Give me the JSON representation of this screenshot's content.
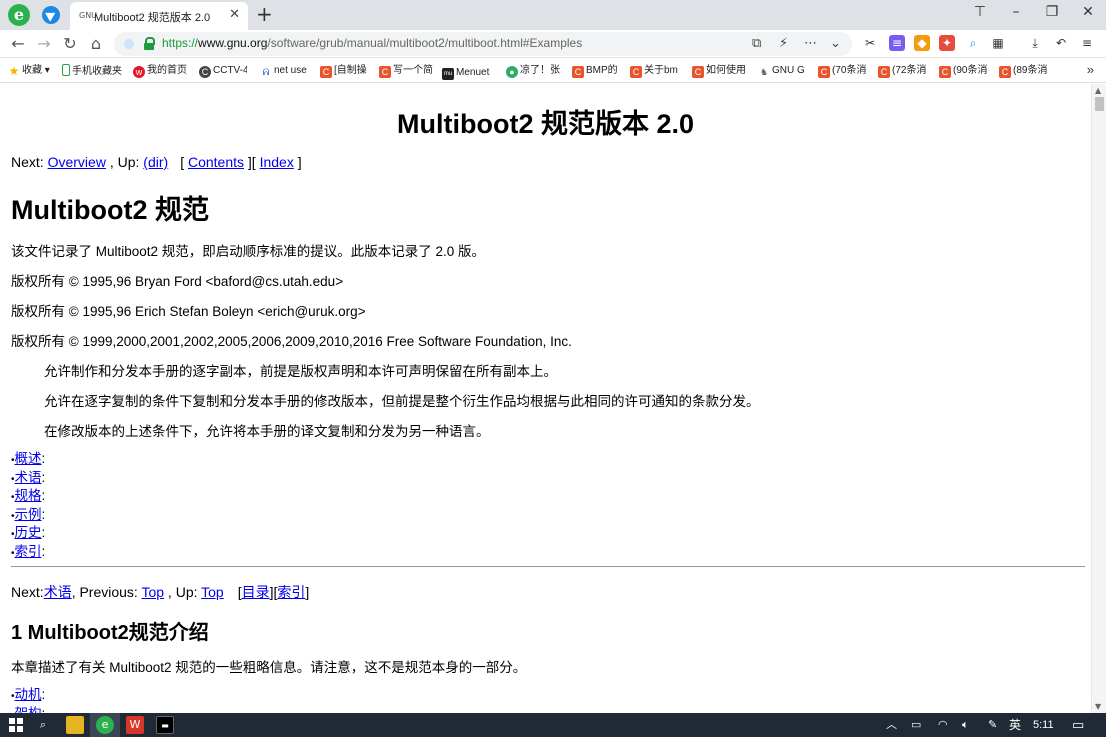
{
  "browser": {
    "tab_favicon": "GNU",
    "tab_title": "Multiboot2 规范版本 2.0",
    "url_scheme": "https://",
    "url_host": "www.gnu.org",
    "url_path": "/software/grub/manual/multiboot2/multiboot.html#Examples",
    "bookmarks": [
      "收藏",
      "手机收藏夹",
      "我的首页",
      "CCTV-4",
      "net use",
      "[自制操",
      "写一个简",
      "Menuet",
      "凉了！张",
      "BMP的",
      "关于bm",
      "如何使用",
      "GNU G",
      "(70条消",
      "(72条消",
      "(90条消",
      "(89条消"
    ],
    "more_label": "»"
  },
  "page": {
    "title": "Multiboot2 规范版本 2.0",
    "nav1": {
      "next_label": "Next: ",
      "next_link": "Overview",
      "up_label": " , Up: ",
      "up_link": "(dir)",
      "open": "[ ",
      "contents_link": "Contents",
      "mid": " ][ ",
      "index_link": "Index",
      "close": " ]"
    },
    "section_title": "Multiboot2 规范",
    "paragraphs": [
      "该文件记录了 Multiboot2 规范，即启动顺序标准的提议。此版本记录了 2.0 版。",
      "版权所有 © 1995,96 Bryan Ford <baford@cs.utah.edu>",
      "版权所有 © 1995,96 Erich Stefan Boleyn <erich@uruk.org>",
      "版权所有 © 1999,2000,2001,2002,2005,2006,2009,2010,2016 Free Software Foundation, Inc."
    ],
    "indented": [
      "允许制作和分发本手册的逐字副本，前提是版权声明和本许可声明保留在所有副本上。",
      "允许在逐字复制的条件下复制和分发本手册的修改版本，但前提是整个衍生作品均根据与此相同的许可通知的条款分发。",
      "在修改版本的上述条件下，允许将本手册的译文复制和分发为另一种语言。"
    ],
    "toc_bullet": "•",
    "toc_suffix": ":",
    "toc": [
      "概述",
      "术语",
      "规格",
      "示例",
      "历史",
      "索引"
    ],
    "nav2": {
      "next_label": "Next:",
      "next_link": "术语",
      "prev_label": ", Previous: ",
      "prev_link": "Top",
      "up_label": " , Up: ",
      "up_link": "Top",
      "open": "[",
      "contents_link": "目录",
      "mid": "][",
      "index_link": "索引",
      "close": "]"
    },
    "chapter_title": "1 Multiboot2规范介绍",
    "chapter_intro": "本章描述了有关 Multiboot2 规范的一些粗略信息。请注意，这不是规范本身的一部分。",
    "toc2": [
      "动机",
      "架构"
    ]
  },
  "taskbar": {
    "lang": "英",
    "time": "5:11"
  }
}
